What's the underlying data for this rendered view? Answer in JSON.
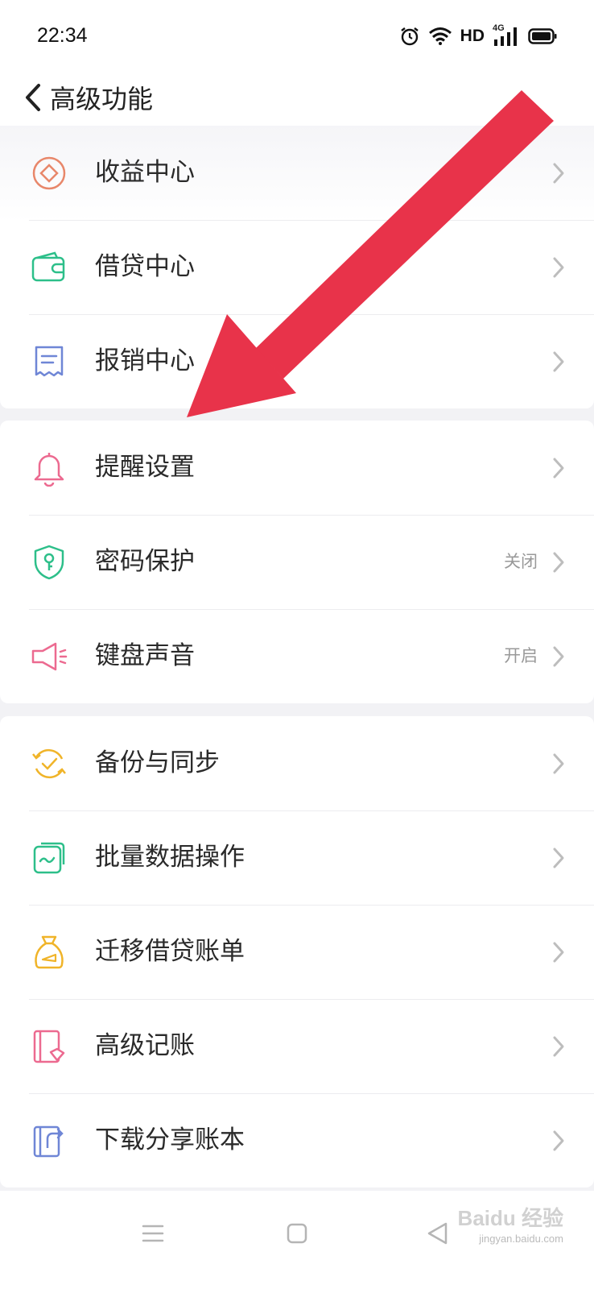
{
  "status_bar": {
    "time": "22:34",
    "network_label": "HD",
    "signal_label": "4G",
    "icons": [
      "alarm-icon",
      "wifi-icon",
      "signal-icon",
      "battery-icon"
    ]
  },
  "header": {
    "back_icon": "back-chevron-icon",
    "title": "高级功能"
  },
  "groups": [
    {
      "items": [
        {
          "label": "收益中心",
          "icon": "income-icon",
          "color": "#e8876a"
        },
        {
          "label": "借贷中心",
          "icon": "wallet-icon",
          "color": "#2dbf8a"
        },
        {
          "label": "报销中心",
          "icon": "receipt-icon",
          "color": "#6f86d6"
        }
      ]
    },
    {
      "items": [
        {
          "label": "提醒设置",
          "icon": "bell-icon",
          "color": "#ec6a90"
        },
        {
          "label": "密码保护",
          "icon": "shield-key-icon",
          "color": "#2dbf8a",
          "value": "关闭"
        },
        {
          "label": "键盘声音",
          "icon": "speaker-icon",
          "color": "#ec6a90",
          "value": "开启"
        }
      ]
    },
    {
      "items": [
        {
          "label": "备份与同步",
          "icon": "sync-check-icon",
          "color": "#f0b429"
        },
        {
          "label": "批量数据操作",
          "icon": "batch-data-icon",
          "color": "#2dbf8a"
        },
        {
          "label": "迁移借贷账单",
          "icon": "money-bag-icon",
          "color": "#f0b429"
        },
        {
          "label": "高级记账",
          "icon": "bookkeeping-icon",
          "color": "#ec6a90"
        },
        {
          "label": "下载分享账本",
          "icon": "share-book-icon",
          "color": "#6f86d6"
        }
      ]
    }
  ],
  "bottom_nav": {
    "icons": [
      "menu-icon",
      "home-icon",
      "back-icon"
    ]
  },
  "watermark": {
    "text": "Baidu 经验",
    "sub": "jingyan.baidu.com"
  },
  "annotation": {
    "color": "#e8334a"
  }
}
